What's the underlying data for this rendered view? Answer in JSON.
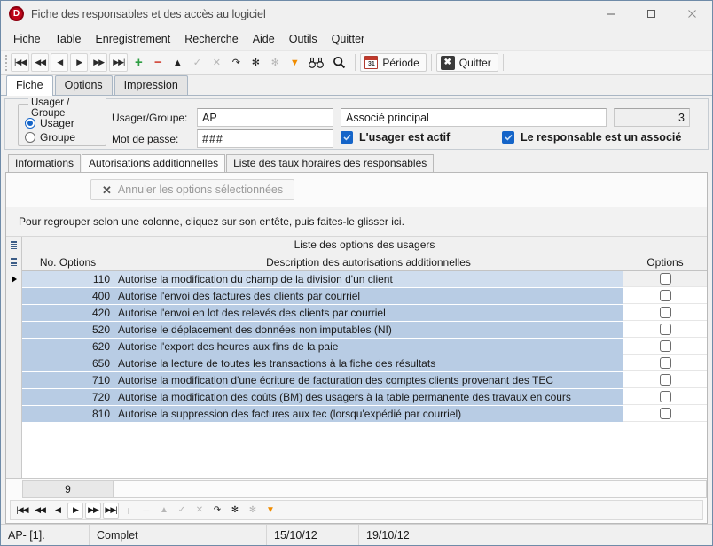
{
  "window": {
    "title": "Fiche des responsables et des accès au logiciel",
    "app_icon": "D",
    "minimize": "minimize-icon",
    "maximize": "maximize-icon",
    "close": "close-icon"
  },
  "menubar": {
    "items": [
      "Fiche",
      "Table",
      "Enregistrement",
      "Recherche",
      "Aide",
      "Outils",
      "Quitter"
    ]
  },
  "toolbar": {
    "nav": [
      "|◀◀",
      "◀◀",
      "◀",
      "▶",
      "▶▶",
      "▶▶|"
    ],
    "add": "+",
    "remove": "−",
    "up": "▲",
    "check": "✓",
    "cancel": "✕",
    "refresh": "↷",
    "star": "✻",
    "star_dim": "✻",
    "filter": "▼",
    "binoculars": "◍◍",
    "search": "search-icon",
    "periode_label": "Période",
    "periode_icon_day": "31",
    "quitter_label": "Quitter",
    "quitter_icon": "✖"
  },
  "tabs": {
    "items": [
      "Fiche",
      "Options",
      "Impression"
    ],
    "active": "Fiche"
  },
  "form": {
    "radio_group_legend": "Usager / Groupe",
    "radio_usager": "Usager",
    "radio_groupe": "Groupe",
    "radio_selected": "Usager",
    "usager_label": "Usager/Groupe:",
    "usager_value": "AP",
    "motdepasse_label": "Mot de passe:",
    "motdepasse_value": "###",
    "description_value": "Associé principal",
    "number_value": "3",
    "checkbox_actif_label": "L'usager est actif",
    "checkbox_actif_checked": true,
    "checkbox_associe_label": "Le responsable est un associé",
    "checkbox_associe_checked": true
  },
  "inner_tabs": {
    "items": [
      "Informations",
      "Autorisations additionnelles",
      "Liste des taux horaires des responsables"
    ],
    "active": "Autorisations additionnelles"
  },
  "actions": {
    "cancel_options_label": "Annuler les options sélectionnées",
    "cancel_options_icon": "✕",
    "cancel_options_enabled": false
  },
  "group_panel": {
    "hint": "Pour regrouper selon une colonne, cliquez sur son entête, puis faites-le glisser ici."
  },
  "grid": {
    "band_title": "Liste des options des usagers",
    "columns": [
      "No. Options",
      "Description des autorisations additionnelles",
      "Options"
    ],
    "rows": [
      {
        "no": "110",
        "description": "Autorise la modification du champ de la division d'un client",
        "checked": false,
        "selected": true
      },
      {
        "no": "400",
        "description": "Autorise l'envoi des factures des clients par courriel",
        "checked": false,
        "selected": false
      },
      {
        "no": "420",
        "description": "Autorise l'envoi en lot des relevés des clients par courriel",
        "checked": false,
        "selected": false
      },
      {
        "no": "520",
        "description": "Autorise le déplacement des données non imputables (NI)",
        "checked": false,
        "selected": false
      },
      {
        "no": "620",
        "description": "Autorise l'export des heures aux fins de la paie",
        "checked": false,
        "selected": false
      },
      {
        "no": "650",
        "description": "Autorise la lecture de toutes les transactions à la fiche des résultats",
        "checked": false,
        "selected": false
      },
      {
        "no": "710",
        "description": "Autorise la modification d'une écriture de facturation des comptes clients provenant des TEC",
        "checked": false,
        "selected": false
      },
      {
        "no": "720",
        "description": "Autorise la modification des coûts (BM) des usagers à la table permanente des travaux en cours",
        "checked": false,
        "selected": false
      },
      {
        "no": "810",
        "description": "Autorise la suppression des factures aux tec (lorsqu'expédié par courriel)",
        "checked": false,
        "selected": false
      }
    ],
    "row_count": "9"
  },
  "statusbar": {
    "record": "AP- [1].",
    "state": "Complet",
    "blank": "",
    "date_created": "15/10/12",
    "date_modified": "19/10/12",
    "end": ""
  },
  "colors": {
    "accent": "#1464c8",
    "row_band": "#b8cce4",
    "row_selected": "#cfddee",
    "brand_red": "#c00418",
    "filter_orange": "#f08c00",
    "add_green": "#2f9e44",
    "remove_red": "#d2483a"
  }
}
